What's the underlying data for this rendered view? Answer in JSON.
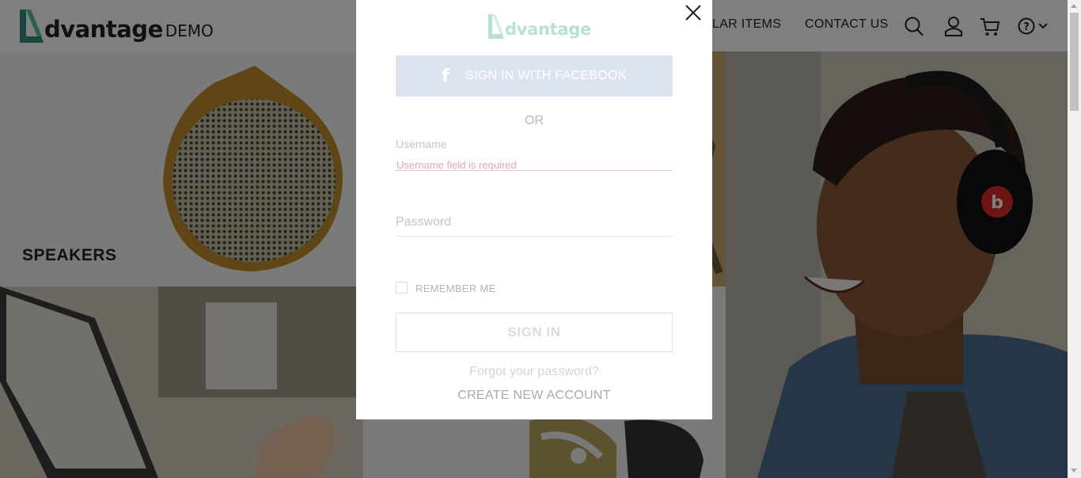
{
  "header": {
    "logo_word": "dvantage",
    "logo_suffix": "DEMO",
    "nav_popular": "LAR ITEMS",
    "nav_contact": "CONTACT US",
    "icons": [
      "search-icon",
      "user-icon",
      "cart-icon",
      "help-icon",
      "chevron-down-icon"
    ]
  },
  "tiles": {
    "speakers_label": "SPEAKERS"
  },
  "modal": {
    "logo_word": "dvantage",
    "facebook_label": "SIGN IN WITH FACEBOOK",
    "or_text": "OR",
    "username_label": "Username",
    "username_error": "Username field is required",
    "password_placeholder": "Password",
    "remember_label": "REMEMBER ME",
    "signin_label": "SIGN IN",
    "forgot_label": "Forgot your password?",
    "create_label": "CREATE NEW ACCOUNT"
  },
  "colors": {
    "brand_teal": "#3aa88f",
    "overlay": "rgba(0,0,0,0.5)",
    "facebook_disabled": "#dde3ef",
    "error_text": "#e6a5ab"
  }
}
